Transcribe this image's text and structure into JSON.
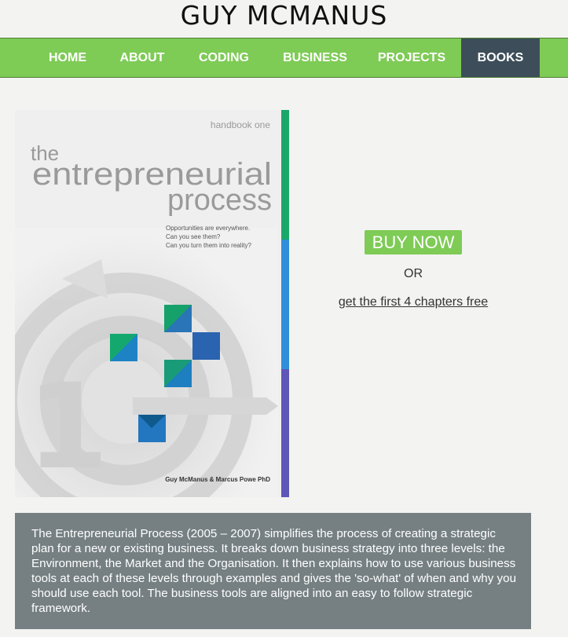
{
  "site": {
    "title": "GUY MCMANUS"
  },
  "nav": {
    "items": [
      {
        "label": "HOME"
      },
      {
        "label": "ABOUT"
      },
      {
        "label": "CODING"
      },
      {
        "label": "BUSINESS"
      },
      {
        "label": "PROJECTS"
      },
      {
        "label": "BOOKS",
        "active": true
      }
    ]
  },
  "book": {
    "cover": {
      "series": "handbook one",
      "title_line1": "the",
      "title_line2": "entrepreneurial",
      "title_line3": "process",
      "tagline1": "Opportunities are everywhere.",
      "tagline2": "Can you see them?",
      "tagline3": "Can you turn them into reality?",
      "authors": "Guy McManus & Marcus Powe PhD",
      "number": "1"
    },
    "buy_label": "BUY NOW",
    "or_label": "OR",
    "free_link": "get the first 4 chapters free",
    "description": "The Entrepreneurial Process (2005 – 2007) simplifies the process of creating a strategic plan for a new or existing business. It breaks down business strategy into three levels: the Environment, the Market and the Organisation. It then explains how to use various business tools at each of these levels through examples and gives the 'so-what' of when and why you should use each tool. The business tools are aligned into an easy to follow strategic framework."
  },
  "colors": {
    "nav_green": "#7ecb56",
    "nav_active": "#3d4e5a",
    "desc_bg": "#768083",
    "spine_green": "#1aa86a",
    "spine_blue": "#2f8fd8",
    "spine_purple": "#5e57b8"
  }
}
